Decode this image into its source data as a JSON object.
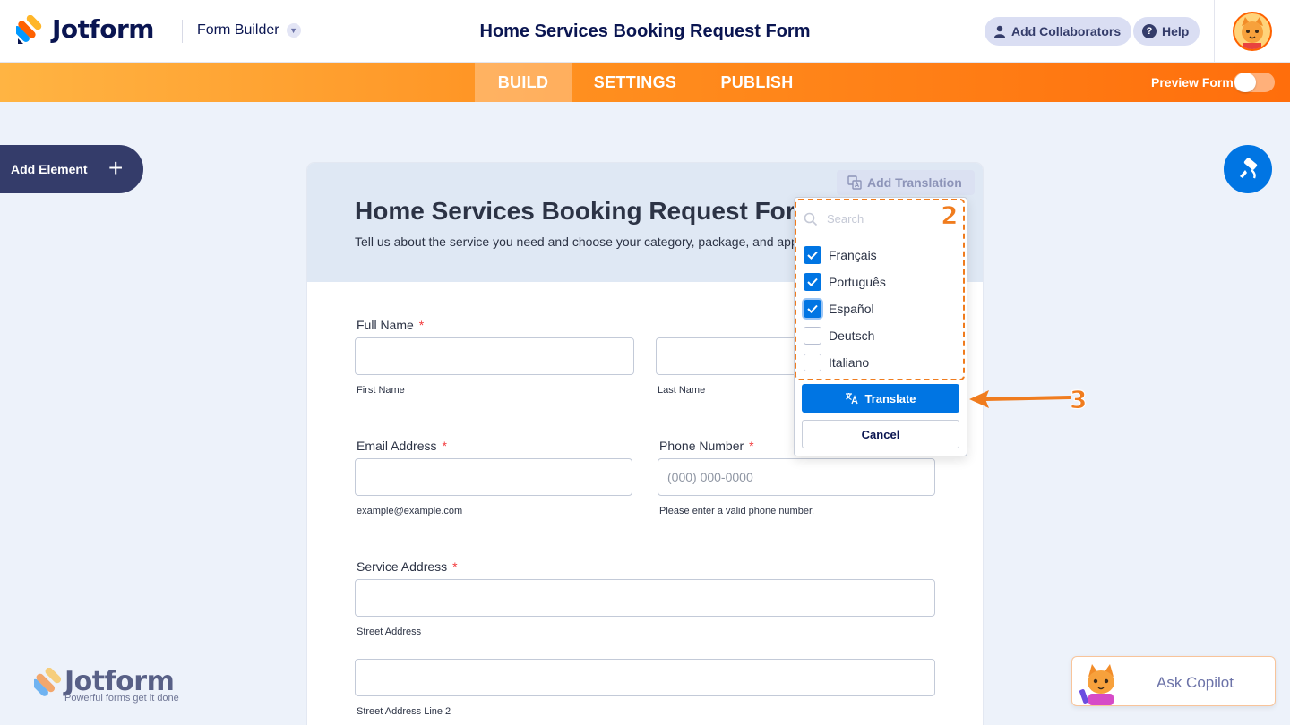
{
  "header": {
    "brand": "Jotform",
    "builder_menu": "Form Builder",
    "form_title": "Home Services Booking Request Form",
    "collaborators_label": "Add Collaborators",
    "help_label": "Help"
  },
  "nav": {
    "tabs": [
      "BUILD",
      "SETTINGS",
      "PUBLISH"
    ],
    "active_tab": "BUILD",
    "preview_label": "Preview Form",
    "preview_on": false
  },
  "sidebar": {
    "add_element_label": "Add Element"
  },
  "form": {
    "title": "Home Services Booking Request Form",
    "subtitle": "Tell us about the service you need and choose your category, package, and appointment details.",
    "add_translation_label": "Add Translation",
    "fields": {
      "full_name": {
        "label": "Full Name",
        "required": "*",
        "first_sublabel": "First Name",
        "last_sublabel": "Last Name"
      },
      "email": {
        "label": "Email Address",
        "required": "*",
        "sublabel": "example@example.com"
      },
      "phone": {
        "label": "Phone Number",
        "required": "*",
        "placeholder": "(000) 000-0000",
        "sublabel": "Please enter a valid phone number."
      },
      "address": {
        "label": "Service Address",
        "required": "*",
        "line1_sublabel": "Street Address",
        "line2_sublabel": "Street Address Line 2"
      }
    }
  },
  "translation_dropdown": {
    "search_placeholder": "Search",
    "languages": [
      {
        "name": "Français",
        "checked": true
      },
      {
        "name": "Português",
        "checked": true
      },
      {
        "name": "Español",
        "checked": true
      },
      {
        "name": "Deutsch",
        "checked": false
      },
      {
        "name": "Italiano",
        "checked": false
      }
    ],
    "translate_label": "Translate",
    "cancel_label": "Cancel"
  },
  "annotations": {
    "step2": "2",
    "step3": "3"
  },
  "watermark": {
    "brand": "Jotform",
    "tagline": "Powerful forms get it done"
  },
  "copilot": {
    "label": "Ask Copilot"
  },
  "colors": {
    "accent_blue": "#0075e3",
    "navy": "#0a1551",
    "orange": "#ff6100",
    "annotation_orange": "#f07c1e"
  }
}
